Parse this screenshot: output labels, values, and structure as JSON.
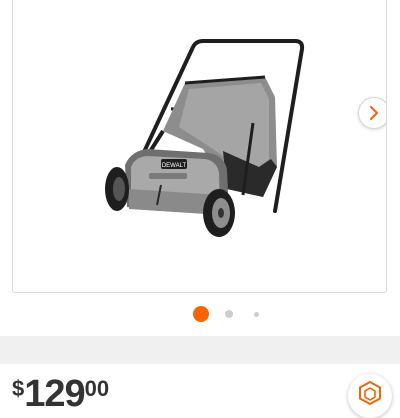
{
  "gallery": {
    "image_icon": "lawn-sweeper-product-image",
    "brand_badge_text": "DEWALT",
    "next_icon": "chevron-right-icon",
    "active_dot_color": "#f96302",
    "inactive_dot_color": "#cccccc",
    "current_slide": 1
  },
  "price": {
    "currency_symbol": "$",
    "whole": "129",
    "cents": "00"
  },
  "store_icon": "store-hexagon-icon",
  "accent_color": "#f96302"
}
